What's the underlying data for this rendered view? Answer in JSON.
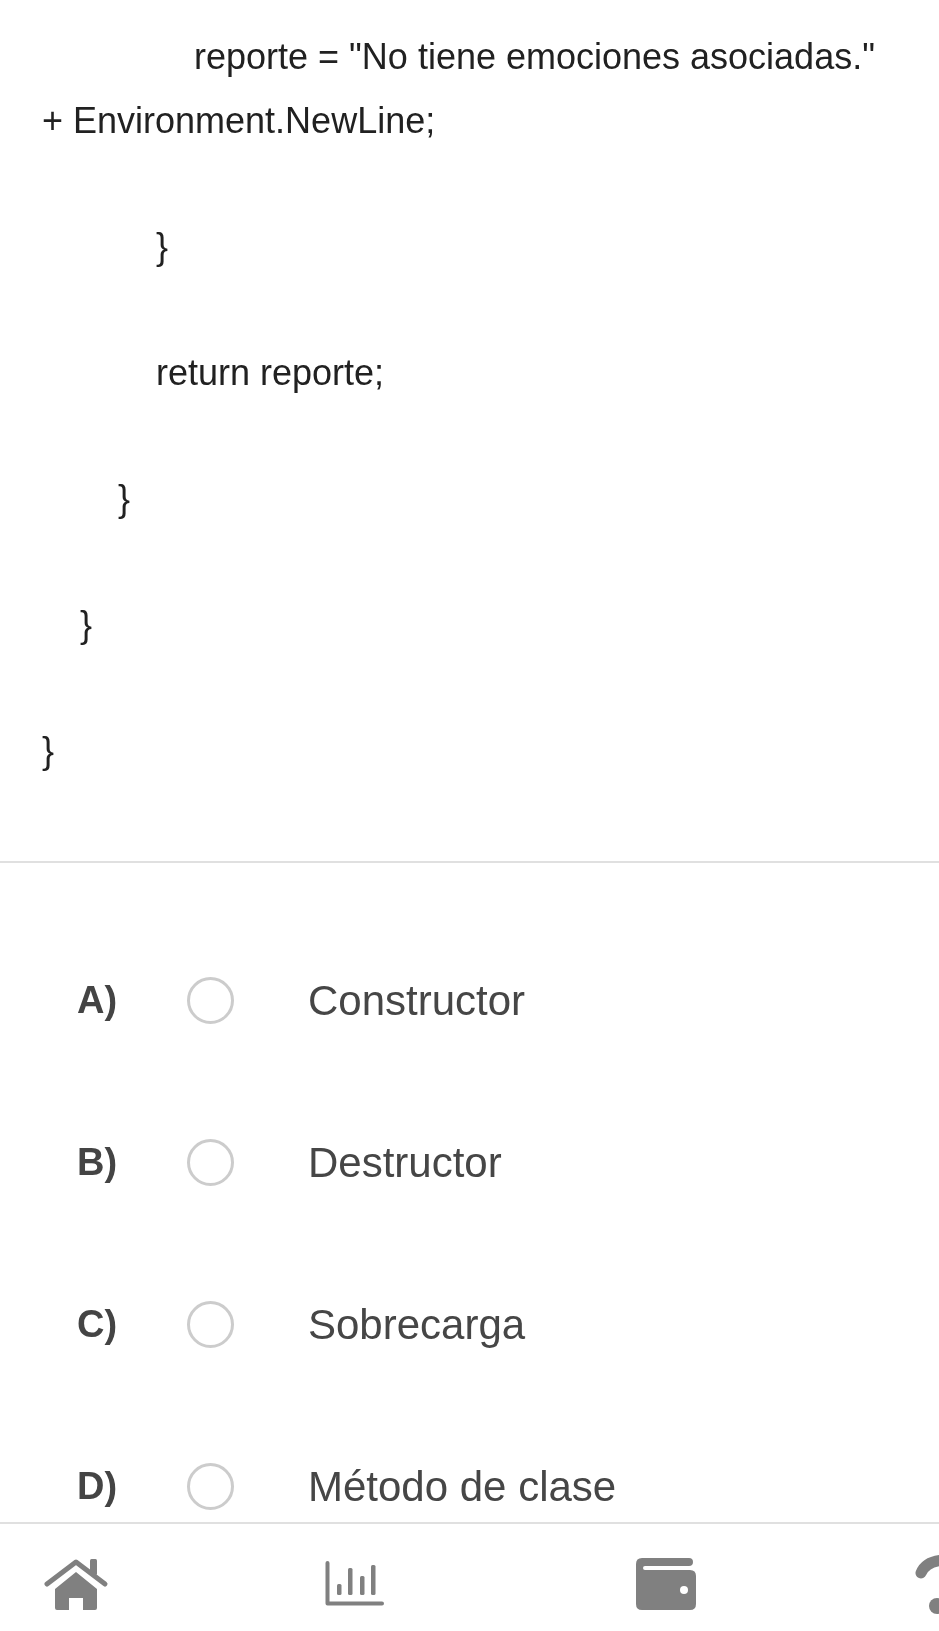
{
  "code": [
    {
      "children": [
        {
          "children": [
            {
              "children": [
                {
                  "children": [
                    {
                      "text": "reporte = \"No tiene emociones asociadas.\" + Environment.NewLine;"
                    }
                  ]
                },
                {
                  "text": "}"
                },
                {
                  "text": "return reporte;"
                }
              ]
            },
            {
              "text": "}"
            }
          ]
        },
        {
          "text": "}"
        }
      ]
    },
    {
      "text": "}"
    }
  ],
  "options": [
    {
      "letter": "A)",
      "text": "Constructor",
      "selected": false
    },
    {
      "letter": "B)",
      "text": "Destructor",
      "selected": false
    },
    {
      "letter": "C)",
      "text": "Sobrecarga",
      "selected": false
    },
    {
      "letter": "D)",
      "text": "Método de clase",
      "selected": false
    }
  ]
}
